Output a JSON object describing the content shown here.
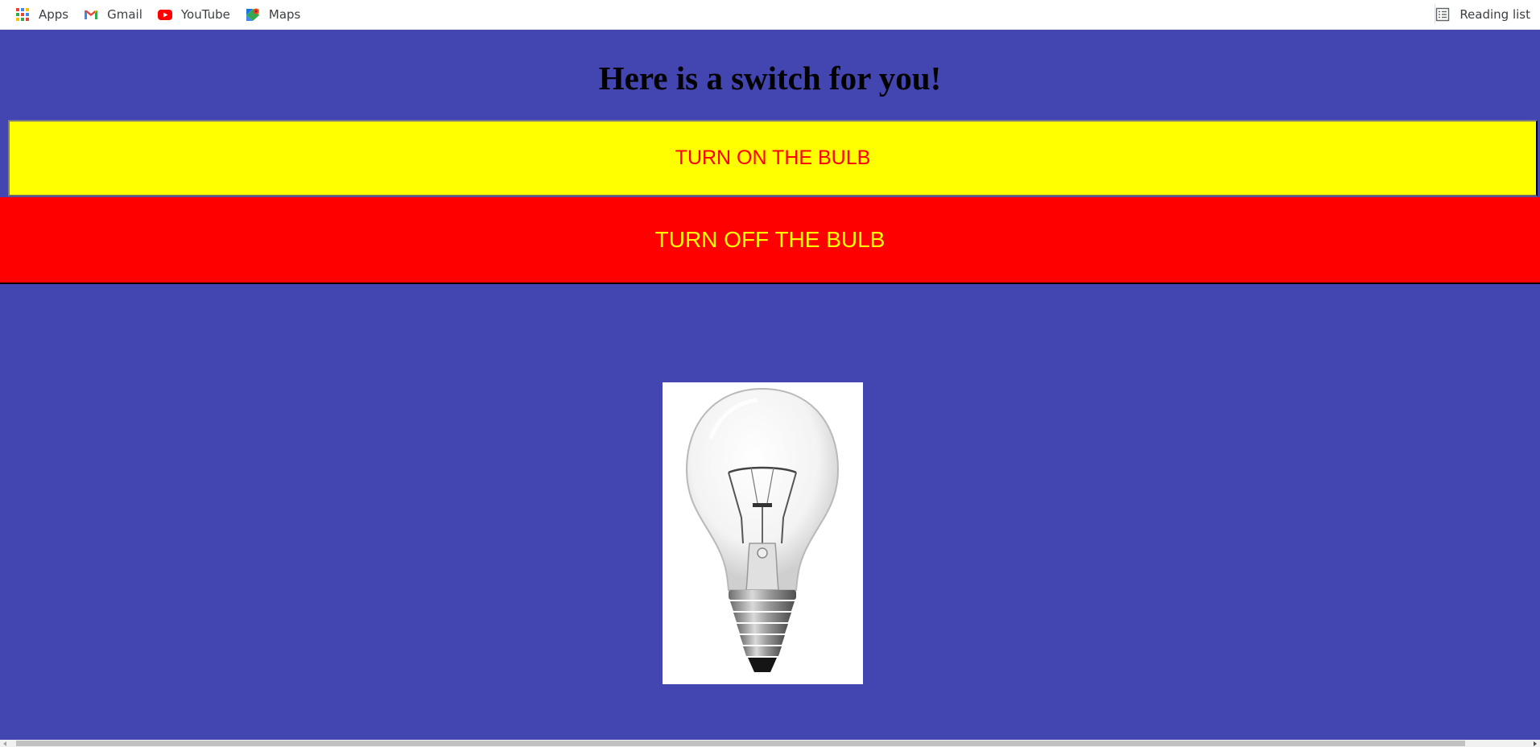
{
  "bookmarks": {
    "items": [
      {
        "label": "Apps",
        "icon": "apps-grid-icon"
      },
      {
        "label": "Gmail",
        "icon": "gmail-icon"
      },
      {
        "label": "YouTube",
        "icon": "youtube-icon"
      },
      {
        "label": "Maps",
        "icon": "maps-icon"
      }
    ],
    "reading_list": {
      "label": "Reading list",
      "icon": "reading-list-icon"
    }
  },
  "page": {
    "background": "#4346b0",
    "title": "Here is a switch for you!",
    "on_button": {
      "label": "TURN ON THE BULB",
      "bg": "#ffff00",
      "color": "#ff0000"
    },
    "off_button": {
      "label": "TURN OFF THE BULB",
      "bg": "#ff0000",
      "color": "#ffff00"
    },
    "bulb_image": {
      "state": "off",
      "icon": "light-bulb-icon"
    }
  }
}
